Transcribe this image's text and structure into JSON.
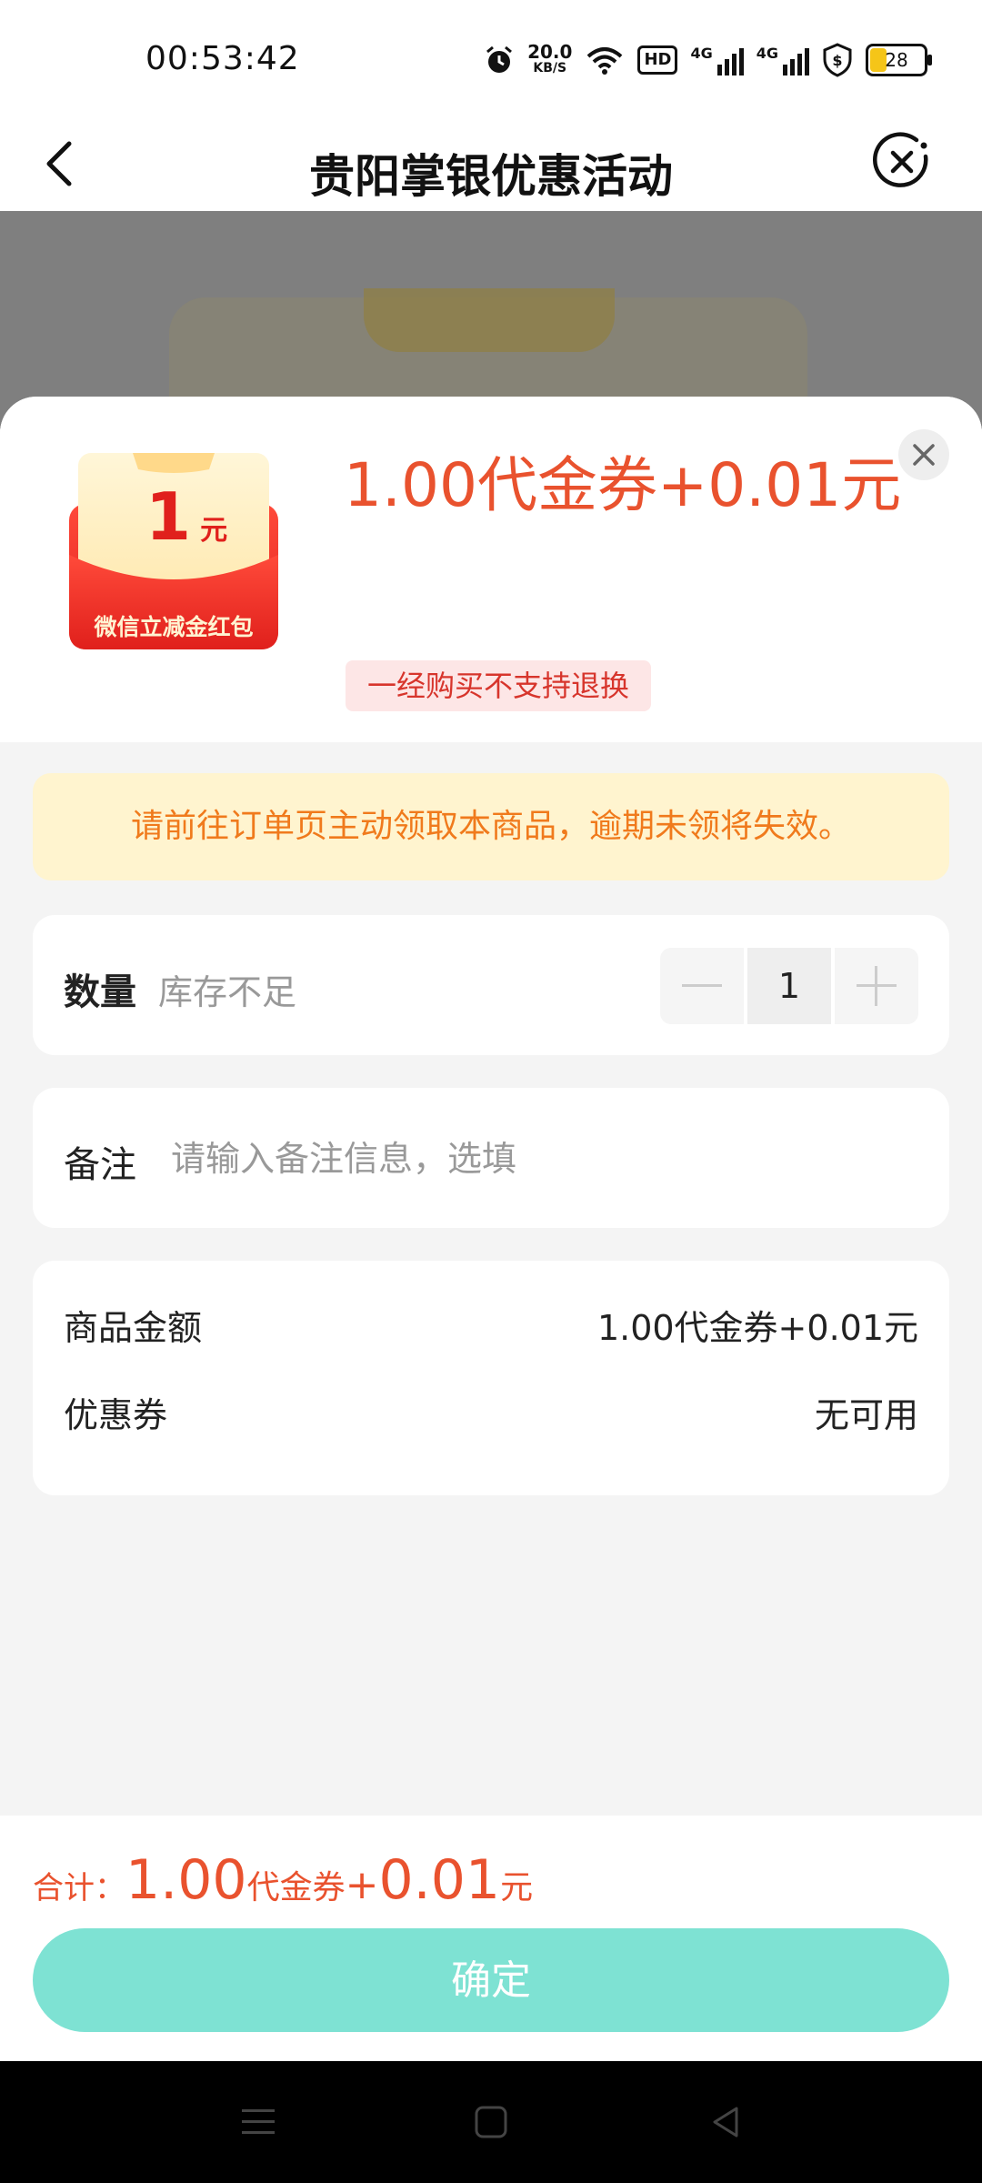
{
  "status_bar": {
    "time": "00:53:42",
    "net_speed_value": "20.0",
    "net_speed_unit": "KB/S",
    "hd_label": "HD",
    "signal1_label": "4G",
    "signal2_label": "4G",
    "battery_level": "28",
    "icons": [
      "alarm-icon",
      "wifi-icon",
      "hd-icon",
      "signal-icon",
      "signal-icon",
      "shield-icon",
      "battery-icon"
    ]
  },
  "nav": {
    "title": "贵阳掌银优惠活动",
    "back_icon": "chevron-left-icon",
    "close_icon": "close-circle-icon"
  },
  "product": {
    "image_amount": "1",
    "image_unit": "元",
    "image_caption": "微信立减金红包",
    "price_title": "1.00代金券+0.01元",
    "refund_tag": "一经购买不支持退换"
  },
  "notice": {
    "text": "请前往订单页主动领取本商品，逾期未领将失效。"
  },
  "quantity": {
    "label": "数量",
    "stock_status": "库存不足",
    "value": "1"
  },
  "remark": {
    "label": "备注",
    "placeholder": "请输入备注信息，选填"
  },
  "summary": {
    "rows": [
      {
        "label": "商品金额",
        "value": "1.00代金券+0.01元"
      },
      {
        "label": "优惠券",
        "value": "无可用"
      }
    ]
  },
  "footer": {
    "total_label": "合计：",
    "total_amount": "1.00",
    "total_unit_voucher": "代金券",
    "total_plus": "+",
    "total_cash": "0.01",
    "total_unit_cash": "元",
    "confirm_label": "确定"
  },
  "colors": {
    "accent_red": "#e9522e",
    "confirm_button": "#7ee2d3",
    "notice_bg": "#fff4cf",
    "notice_text": "#f07a1c"
  }
}
